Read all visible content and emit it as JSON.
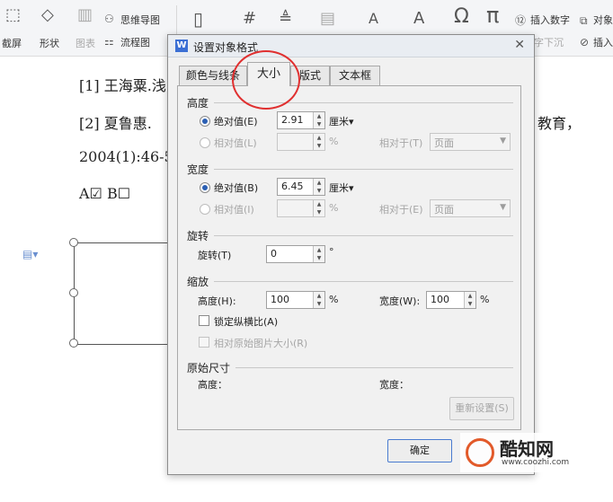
{
  "ribbon": {
    "screenshot_label": "截屏",
    "shapes_label": "形状",
    "chart_label": "图表",
    "mindmap_label": "思维导图",
    "flowchart_label": "流程图",
    "insert_number_label": "插入数字",
    "object_label": "对象",
    "insert_label": "插入",
    "hidden_text": "字下沉"
  },
  "document": {
    "line1": "[1] 王海粟.浅",
    "line2a": "[2]  夏鲁惠.",
    "line2b": "教育，",
    "line3": "2004(1):46-5",
    "line4": "A☑   B☐"
  },
  "dialog": {
    "title": "设置对象格式",
    "tabs": [
      "颜色与线条",
      "大小",
      "版式",
      "文本框"
    ],
    "height": {
      "section": "高度",
      "absolute_label": "绝对值(E)",
      "absolute_value": "2.91",
      "unit": "厘米▾",
      "relative_label": "相对值(L)",
      "percent": "%",
      "relative_to_label": "相对于(T)",
      "relative_to_value": "页面"
    },
    "width": {
      "section": "宽度",
      "absolute_label": "绝对值(B)",
      "absolute_value": "6.45",
      "unit": "厘米▾",
      "relative_label": "相对值(I)",
      "percent": "%",
      "relative_to_label": "相对于(E)",
      "relative_to_value": "页面"
    },
    "rotate": {
      "section": "旋转",
      "label": "旋转(T)",
      "value": "0",
      "unit": "°"
    },
    "scale": {
      "section": "缩放",
      "height_label": "高度(H):",
      "height_value": "100",
      "width_label": "宽度(W):",
      "width_value": "100",
      "percent": "%",
      "lock_ratio": "锁定纵横比(A)",
      "relative_original": "相对原始图片大小(R)"
    },
    "original": {
      "section": "原始尺寸",
      "height_label": "高度：",
      "width_label": "宽度："
    },
    "reset_button": "重新设置(S)",
    "ok_button": "确定"
  },
  "watermark": {
    "brand": "酷知网",
    "url": "www.coozhi.com"
  }
}
